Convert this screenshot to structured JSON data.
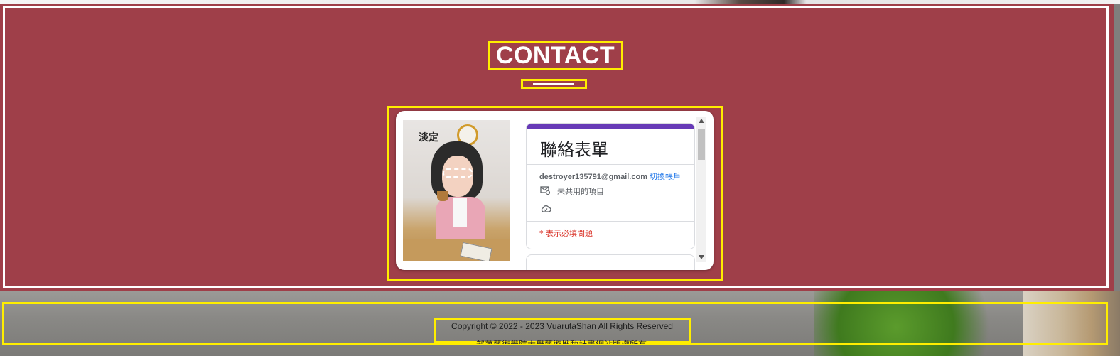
{
  "contact": {
    "title": "CONTACT"
  },
  "form": {
    "title": "聯絡表單",
    "account_email": "destroyer135791@gmail.com",
    "switch_account": "切換帳戶",
    "not_shared": "未共用的項目",
    "required_note": "* 表示必填問題",
    "avatar_sign": "淡定",
    "icons": [
      "mail-shared-icon",
      "cloud-check-icon"
    ],
    "accent_color": "#673ab7"
  },
  "footer": {
    "copyright": "Copyright © 2022 - 2023 VuarutaShan All Rights Reserved",
    "subline": "部落藝術學院大學藝術推動計畫網站版權所有"
  },
  "colors": {
    "section_bg": "#9f3f49",
    "highlight": "#ffee00"
  }
}
